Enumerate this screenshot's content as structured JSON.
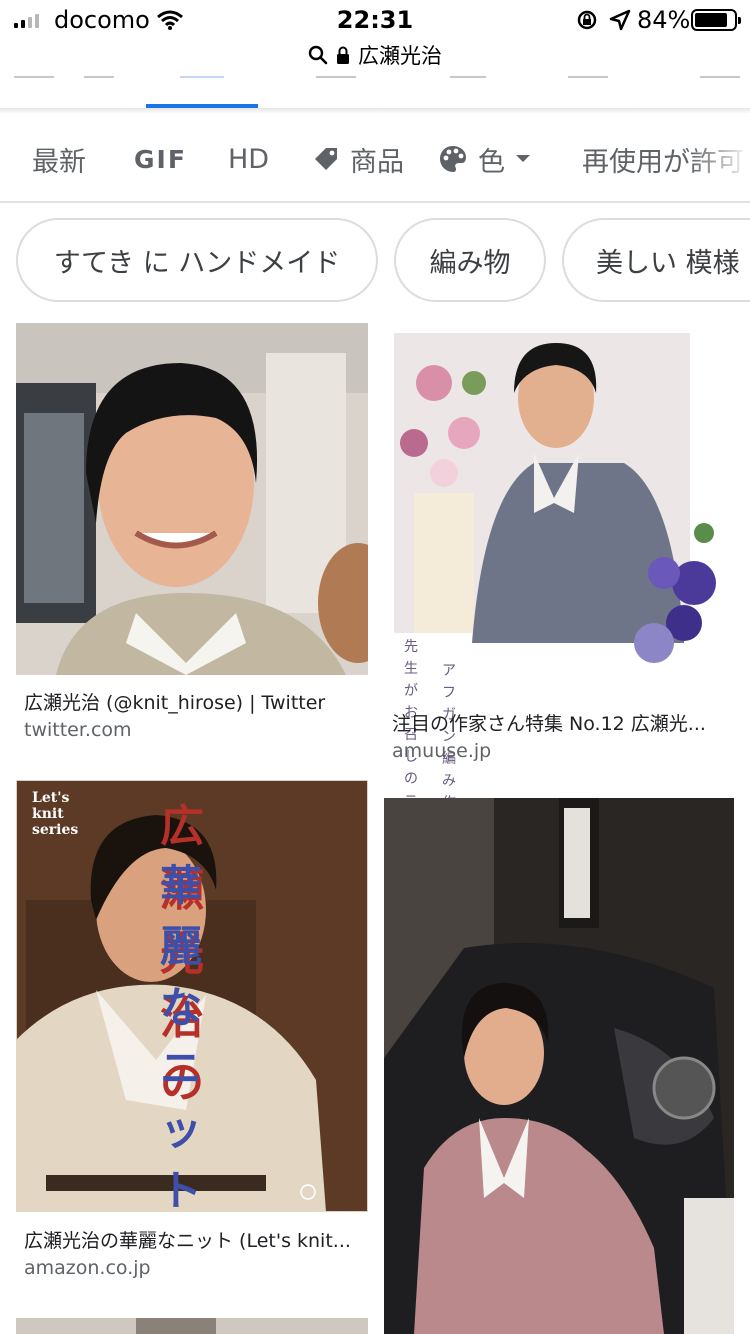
{
  "status_bar": {
    "carrier": "docomo",
    "time": "22:31",
    "battery_percent": "84%",
    "battery_level": 0.84
  },
  "url_bar": {
    "query": "広瀬光治"
  },
  "filters": [
    "最新",
    "GIF",
    "HD",
    "商品",
    "色",
    "再使用が許可"
  ],
  "chips": [
    "すてき に ハンドメイド",
    "編み物",
    "美しい 模様"
  ],
  "results": [
    {
      "title": "広瀬光治 (@knit_hirose) | Twitter",
      "source": "twitter.com"
    },
    {
      "title": "注目の作家さん特集 No.12 広瀬光...",
      "source": "amuuse.jp",
      "overlay_line1": "先生がお召しのニットも",
      "overlay_line2": "アフガン編み作品です。"
    },
    {
      "title": "広瀬光治の華麗なニット (Let's knit...",
      "source": "amazon.co.jp",
      "cover_series": "Let's knit series",
      "cover_name_line1": "広瀬光治の",
      "cover_name_line2": "華麗なニット"
    },
    {
      "title": "",
      "source": ""
    }
  ],
  "colors": {
    "accent": "#1a73e8",
    "text_primary": "#202124",
    "text_secondary": "#5f6368",
    "chip_border": "#dadce0"
  }
}
